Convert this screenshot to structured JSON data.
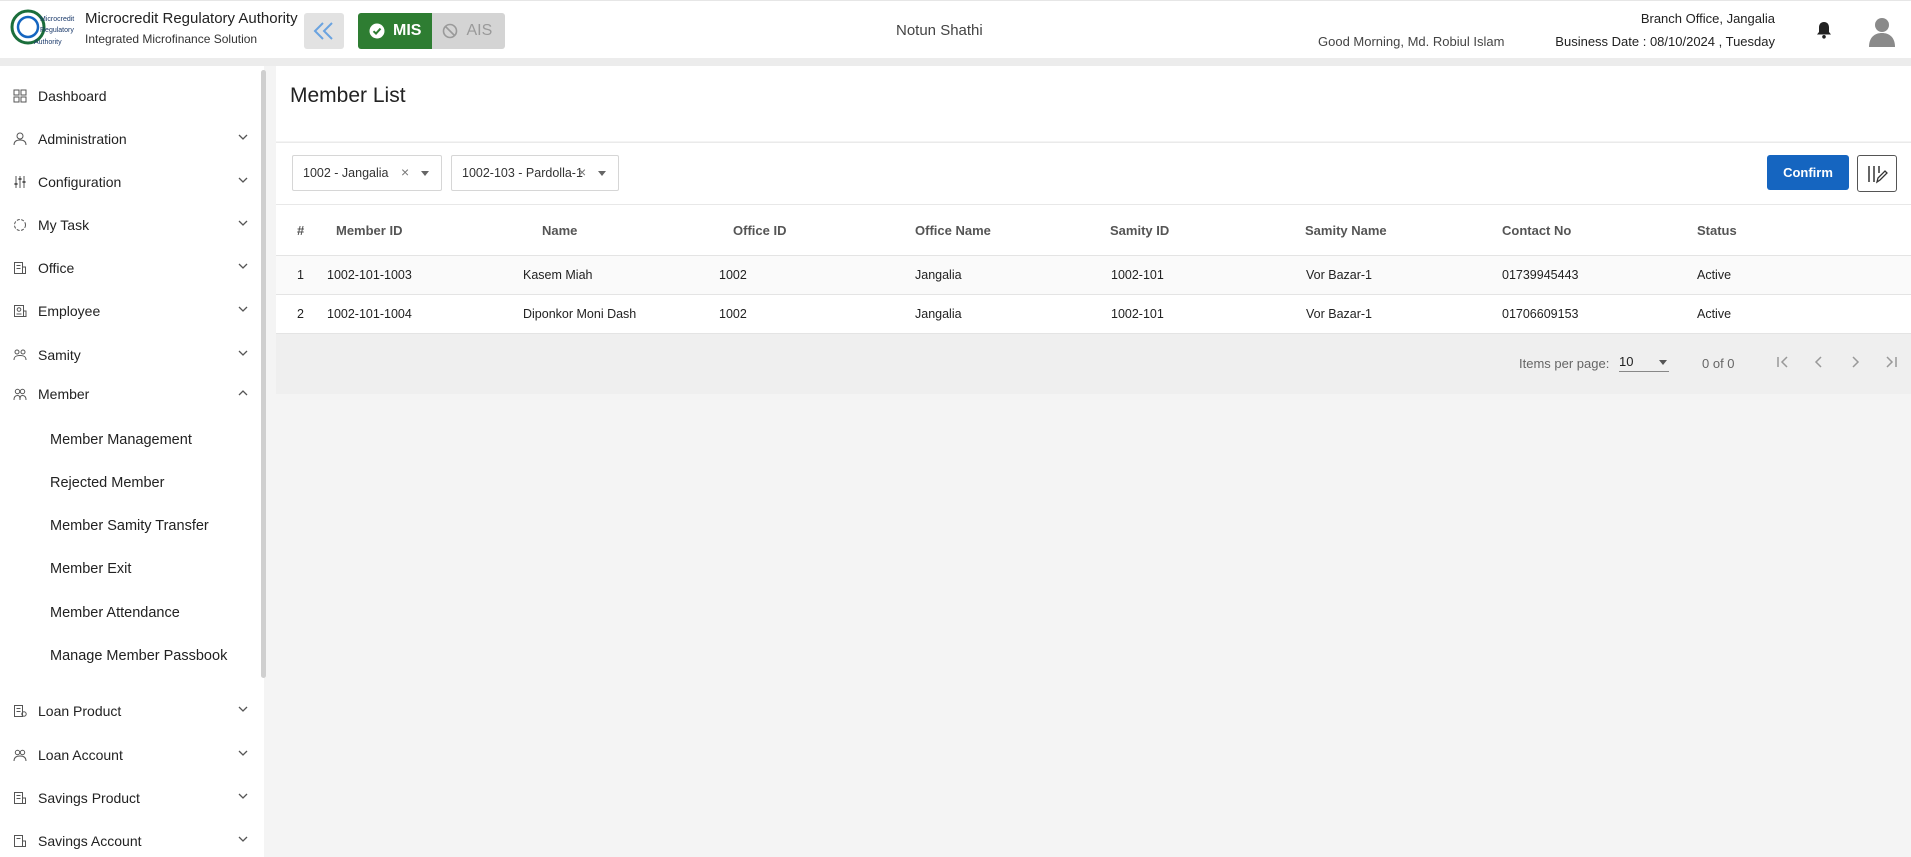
{
  "header": {
    "logo_text": [
      "Microcredit",
      "Regulatory",
      "Authority"
    ],
    "org_name": "Microcredit Regulatory Authority",
    "org_subtitle": "Integrated Microfinance Solution",
    "mode_active": "MIS",
    "mode_inactive": "AIS",
    "app_name": "Notun Shathi",
    "greeting": "Good Morning, Md. Robiul Islam",
    "branch": "Branch Office, Jangalia",
    "business_date": "Business Date : 08/10/2024 , Tuesday",
    "colors": {
      "mis": "#2e7d32",
      "accent": "#1565c0"
    }
  },
  "sidebar": {
    "items": [
      {
        "label": "Dashboard",
        "icon": "dashboard-icon"
      },
      {
        "label": "Administration",
        "icon": "administration-icon"
      },
      {
        "label": "Configuration",
        "icon": "configuration-icon"
      },
      {
        "label": "My Task",
        "icon": "task-icon"
      },
      {
        "label": "Office",
        "icon": "office-icon"
      },
      {
        "label": "Employee",
        "icon": "employee-icon"
      },
      {
        "label": "Samity",
        "icon": "samity-icon"
      },
      {
        "label": "Member",
        "icon": "member-icon"
      },
      {
        "label": "Loan Product",
        "icon": "loan-product-icon"
      },
      {
        "label": "Loan Account",
        "icon": "loan-account-icon"
      },
      {
        "label": "Savings Product",
        "icon": "savings-product-icon"
      },
      {
        "label": "Savings Account",
        "icon": "savings-account-icon"
      }
    ],
    "member_sub_items": [
      "Member Management",
      "Rejected Member",
      "Member Samity Transfer",
      "Member Exit",
      "Member Attendance",
      "Manage Member Passbook"
    ]
  },
  "main": {
    "title": "Member List",
    "filters": {
      "office": "1002 - Jangalia",
      "samity": "1002-103 - Pardolla-1"
    },
    "confirm_label": "Confirm",
    "table": {
      "headers": [
        "#",
        "Member ID",
        "Name",
        "Office ID",
        "Office Name",
        "Samity ID",
        "Samity Name",
        "Contact No",
        "Status"
      ],
      "rows": [
        [
          "1",
          "1002-101-1003",
          "Kasem Miah",
          "1002",
          "Jangalia",
          "1002-101",
          "Vor Bazar-1",
          "01739945443",
          "Active"
        ],
        [
          "2",
          "1002-101-1004",
          "Diponkor Moni Dash",
          "1002",
          "Jangalia",
          "1002-101",
          "Vor Bazar-1",
          "01706609153",
          "Active"
        ]
      ]
    },
    "paginator": {
      "items_per_page_label": "Items per page:",
      "page_size": "10",
      "range": "0 of 0"
    }
  }
}
